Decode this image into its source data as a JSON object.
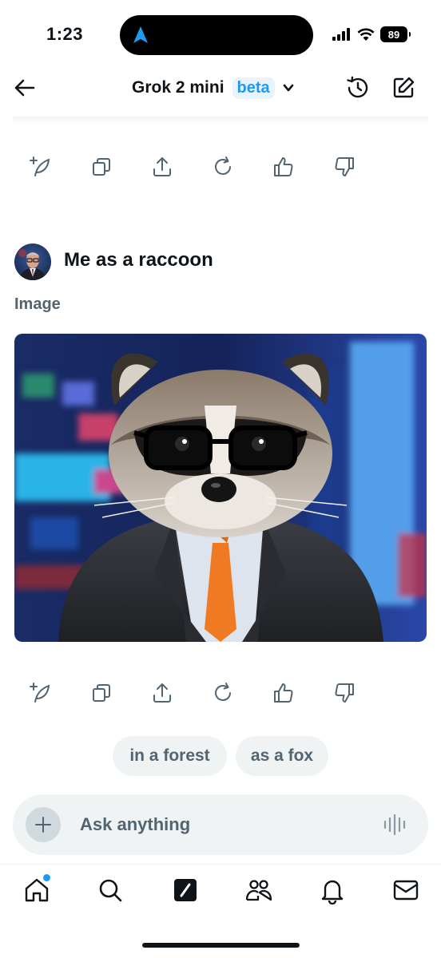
{
  "status_bar": {
    "time": "1:23",
    "battery": "89"
  },
  "header": {
    "title": "Grok 2 mini",
    "badge": "beta"
  },
  "message": {
    "text": "Me as a raccoon",
    "attachment_label": "Image"
  },
  "action_icons": [
    "new-post-icon",
    "copy-icon",
    "share-icon",
    "regenerate-icon",
    "like-icon",
    "dislike-icon"
  ],
  "suggestions": [
    "in a forest",
    "as a fox"
  ],
  "composer": {
    "placeholder": "Ask anything"
  },
  "tabs": [
    "home-icon",
    "search-icon",
    "grok-icon",
    "communities-icon",
    "notifications-icon",
    "messages-icon"
  ],
  "colors": {
    "accent": "#1d9bf0",
    "secondary_text": "#536471",
    "chip_bg": "#eff3f4"
  }
}
